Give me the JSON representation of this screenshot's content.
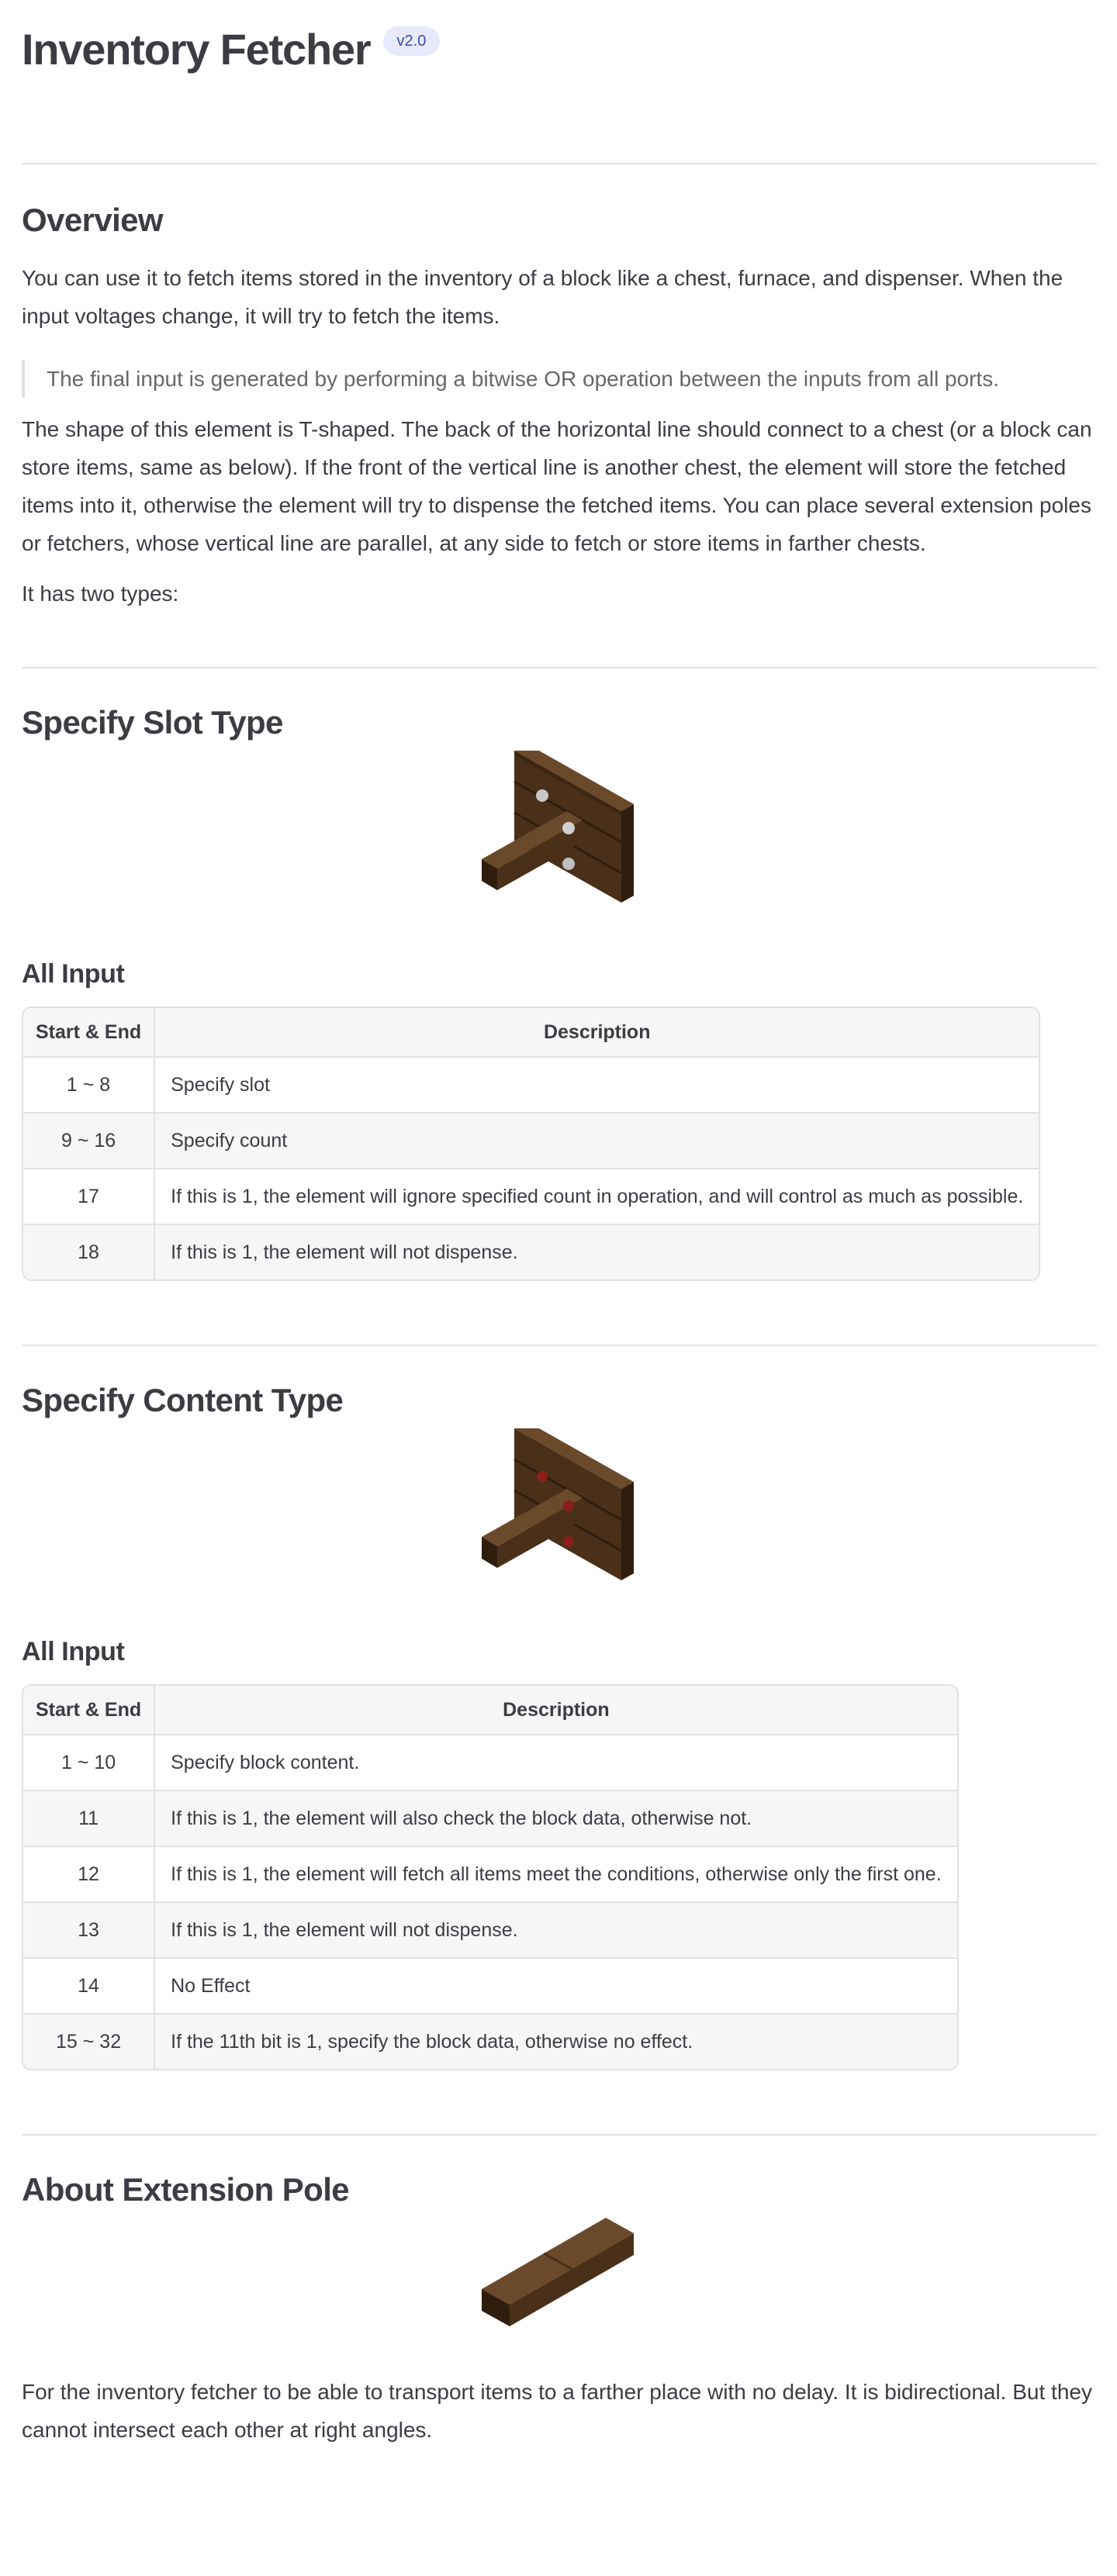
{
  "header": {
    "title": "Inventory Fetcher",
    "version": "v2.0"
  },
  "overview": {
    "heading": "Overview",
    "p1": "You can use it to fetch items stored in the inventory of a block like a chest, furnace, and dispenser. When the input voltages change, it will try to fetch the items.",
    "quote": "The final input is generated by performing a bitwise OR operation between the inputs from all ports.",
    "p2": "The shape of this element is T-shaped. The back of the horizontal line should connect to a chest (or a block can store items, same as below). If the front of the vertical line is another chest, the element will store the fetched items into it, otherwise the element will try to dispense the fetched items. You can place several extension poles or fetchers, whose vertical line are parallel, at any side to fetch or store items in farther chests.",
    "p3": "It has two types:"
  },
  "slot_type": {
    "heading": "Specify Slot Type",
    "image_icon": "inventory-fetcher-slot-type-block-icon",
    "table_heading": "All Input",
    "columns": [
      "Start & End",
      "Description"
    ],
    "rows": [
      {
        "range": "1 ~ 8",
        "desc": "Specify slot"
      },
      {
        "range": "9 ~ 16",
        "desc": "Specify count"
      },
      {
        "range": "17",
        "desc": "If this is 1, the element will ignore specified count in operation, and will control as much as possible."
      },
      {
        "range": "18",
        "desc": "If this is 1, the element will not dispense."
      }
    ]
  },
  "content_type": {
    "heading": "Specify Content Type",
    "image_icon": "inventory-fetcher-content-type-block-icon",
    "table_heading": "All Input",
    "columns": [
      "Start & End",
      "Description"
    ],
    "rows": [
      {
        "range": "1 ~ 10",
        "desc": "Specify block content."
      },
      {
        "range": "11",
        "desc": "If this is 1, the element will also check the block data, otherwise not."
      },
      {
        "range": "12",
        "desc": "If this is 1, the element will fetch all items meet the conditions, otherwise only the first one."
      },
      {
        "range": "13",
        "desc": "If this is 1, the element will not dispense."
      },
      {
        "range": "14",
        "desc": "No Effect"
      },
      {
        "range": "15 ~ 32",
        "desc": "If the 11th bit is 1, specify the block data, otherwise no effect."
      }
    ]
  },
  "extension_pole": {
    "heading": "About Extension Pole",
    "image_icon": "extension-pole-block-icon",
    "p1": "For the inventory fetcher to be able to transport items to a farther place with no delay. It is bidirectional. But they cannot intersect each other at right angles."
  },
  "colors": {
    "text": "#3c3c43",
    "muted": "#67676c",
    "divider": "#e2e2e3",
    "badge_bg": "#e8e9fb",
    "badge_fg": "#3451b2",
    "wood_top": "#6b4a2b",
    "wood_side": "#4a3019",
    "wood_dark": "#2f1d0e"
  }
}
